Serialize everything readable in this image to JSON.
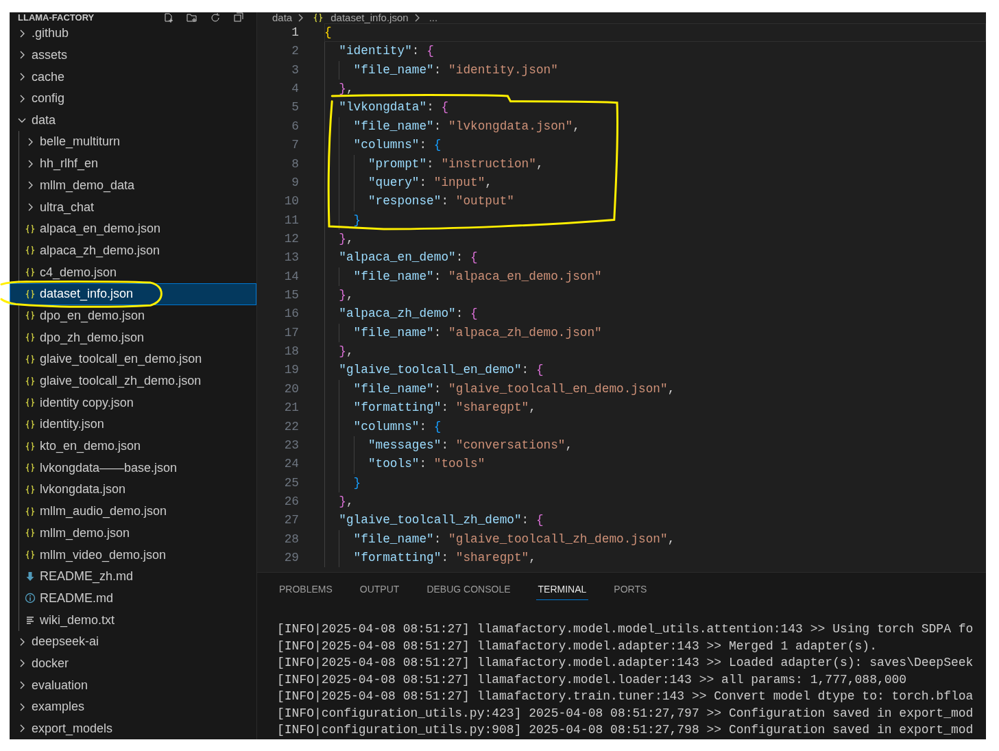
{
  "explorer": {
    "title": "LLAMA-FACTORY",
    "items": [
      {
        "name": ".github",
        "kind": "folder",
        "expanded": false,
        "selected": false
      },
      {
        "name": "assets",
        "kind": "folder",
        "expanded": false,
        "selected": false
      },
      {
        "name": "cache",
        "kind": "folder",
        "expanded": false,
        "selected": false
      },
      {
        "name": "config",
        "kind": "folder",
        "expanded": false,
        "selected": false
      },
      {
        "name": "data",
        "kind": "folder",
        "expanded": true,
        "selected": false,
        "children": [
          {
            "name": "belle_multiturn",
            "kind": "folder",
            "expanded": false,
            "selected": false
          },
          {
            "name": "hh_rlhf_en",
            "kind": "folder",
            "expanded": false,
            "selected": false
          },
          {
            "name": "mllm_demo_data",
            "kind": "folder",
            "expanded": false,
            "selected": false
          },
          {
            "name": "ultra_chat",
            "kind": "folder",
            "expanded": false,
            "selected": false
          },
          {
            "name": "alpaca_en_demo.json",
            "kind": "json",
            "selected": false
          },
          {
            "name": "alpaca_zh_demo.json",
            "kind": "json",
            "selected": false
          },
          {
            "name": "c4_demo.json",
            "kind": "json",
            "selected": false
          },
          {
            "name": "dataset_info.json",
            "kind": "json",
            "selected": true
          },
          {
            "name": "dpo_en_demo.json",
            "kind": "json",
            "selected": false
          },
          {
            "name": "dpo_zh_demo.json",
            "kind": "json",
            "selected": false
          },
          {
            "name": "glaive_toolcall_en_demo.json",
            "kind": "json",
            "selected": false
          },
          {
            "name": "glaive_toolcall_zh_demo.json",
            "kind": "json",
            "selected": false
          },
          {
            "name": "identity copy.json",
            "kind": "json",
            "selected": false
          },
          {
            "name": "identity.json",
            "kind": "json",
            "selected": false
          },
          {
            "name": "kto_en_demo.json",
            "kind": "json",
            "selected": false
          },
          {
            "name": "lvkongdata——base.json",
            "kind": "json",
            "selected": false
          },
          {
            "name": "lvkongdata.json",
            "kind": "json",
            "selected": false
          },
          {
            "name": "mllm_audio_demo.json",
            "kind": "json",
            "selected": false
          },
          {
            "name": "mllm_demo.json",
            "kind": "json",
            "selected": false
          },
          {
            "name": "mllm_video_demo.json",
            "kind": "json",
            "selected": false
          },
          {
            "name": "README_zh.md",
            "kind": "download",
            "selected": false
          },
          {
            "name": "README.md",
            "kind": "info",
            "selected": false
          },
          {
            "name": "wiki_demo.txt",
            "kind": "text",
            "selected": false
          }
        ]
      },
      {
        "name": "deepseek-ai",
        "kind": "folder",
        "expanded": false,
        "selected": false
      },
      {
        "name": "docker",
        "kind": "folder",
        "expanded": false,
        "selected": false
      },
      {
        "name": "evaluation",
        "kind": "folder",
        "expanded": false,
        "selected": false
      },
      {
        "name": "examples",
        "kind": "folder",
        "expanded": false,
        "selected": false
      },
      {
        "name": "export_models",
        "kind": "folder",
        "expanded": false,
        "selected": false
      }
    ]
  },
  "breadcrumb": [
    {
      "text": "data",
      "kind": "folder"
    },
    {
      "text": "dataset_info.json",
      "kind": "json"
    },
    {
      "text": "...",
      "kind": "more"
    }
  ],
  "editor": {
    "lines": [
      {
        "number": "1",
        "current": true,
        "tokens": [
          {
            "kind": "bracket",
            "text": "{",
            "color": "#ffd700"
          }
        ],
        "children": [
          {
            "number": "2",
            "current": false,
            "tokens": [
              {
                "kind": "key",
                "text": "\"identity\""
              },
              {
                "kind": "punct",
                "text": ": "
              },
              {
                "kind": "bracket",
                "text": "{",
                "color": "#da70d6"
              }
            ],
            "children": [
              {
                "number": "3",
                "current": false,
                "tokens": [
                  {
                    "kind": "key",
                    "text": "\"file_name\""
                  },
                  {
                    "kind": "punct",
                    "text": ": "
                  },
                  {
                    "kind": "string",
                    "text": "\"identity.json\""
                  }
                ]
              }
            ]
          },
          {
            "number": "4",
            "current": false,
            "tokens": [
              {
                "kind": "bracket",
                "text": "}",
                "color": "#da70d6"
              },
              {
                "kind": "punct",
                "text": ","
              }
            ]
          },
          {
            "number": "5",
            "current": false,
            "tokens": [
              {
                "kind": "key",
                "text": "\"lvkongdata\""
              },
              {
                "kind": "punct",
                "text": ": "
              },
              {
                "kind": "bracket",
                "text": "{",
                "color": "#da70d6"
              }
            ],
            "children": [
              {
                "number": "6",
                "current": false,
                "tokens": [
                  {
                    "kind": "key",
                    "text": "\"file_name\""
                  },
                  {
                    "kind": "punct",
                    "text": ": "
                  },
                  {
                    "kind": "string",
                    "text": "\"lvkongdata.json\""
                  },
                  {
                    "kind": "punct",
                    "text": ","
                  }
                ]
              },
              {
                "number": "7",
                "current": false,
                "tokens": [
                  {
                    "kind": "key",
                    "text": "\"columns\""
                  },
                  {
                    "kind": "punct",
                    "text": ": "
                  },
                  {
                    "kind": "bracket",
                    "text": "{",
                    "color": "#179fff"
                  }
                ],
                "children": [
                  {
                    "number": "8",
                    "current": false,
                    "tokens": [
                      {
                        "kind": "key",
                        "text": "\"prompt\""
                      },
                      {
                        "kind": "punct",
                        "text": ": "
                      },
                      {
                        "kind": "string",
                        "text": "\"instruction\""
                      },
                      {
                        "kind": "punct",
                        "text": ","
                      }
                    ]
                  },
                  {
                    "number": "9",
                    "current": false,
                    "tokens": [
                      {
                        "kind": "key",
                        "text": "\"query\""
                      },
                      {
                        "kind": "punct",
                        "text": ": "
                      },
                      {
                        "kind": "string",
                        "text": "\"input\""
                      },
                      {
                        "kind": "punct",
                        "text": ","
                      }
                    ]
                  },
                  {
                    "number": "10",
                    "current": false,
                    "tokens": [
                      {
                        "kind": "key",
                        "text": "\"response\""
                      },
                      {
                        "kind": "punct",
                        "text": ": "
                      },
                      {
                        "kind": "string",
                        "text": "\"output\""
                      }
                    ]
                  }
                ]
              },
              {
                "number": "11",
                "current": false,
                "tokens": [
                  {
                    "kind": "bracket",
                    "text": "}",
                    "color": "#179fff"
                  }
                ]
              }
            ]
          },
          {
            "number": "12",
            "current": false,
            "tokens": [
              {
                "kind": "bracket",
                "text": "}",
                "color": "#da70d6"
              },
              {
                "kind": "punct",
                "text": ","
              }
            ]
          },
          {
            "number": "13",
            "current": false,
            "tokens": [
              {
                "kind": "key",
                "text": "\"alpaca_en_demo\""
              },
              {
                "kind": "punct",
                "text": ": "
              },
              {
                "kind": "bracket",
                "text": "{",
                "color": "#da70d6"
              }
            ],
            "children": [
              {
                "number": "14",
                "current": false,
                "tokens": [
                  {
                    "kind": "key",
                    "text": "\"file_name\""
                  },
                  {
                    "kind": "punct",
                    "text": ": "
                  },
                  {
                    "kind": "string",
                    "text": "\"alpaca_en_demo.json\""
                  }
                ]
              }
            ]
          },
          {
            "number": "15",
            "current": false,
            "tokens": [
              {
                "kind": "bracket",
                "text": "}",
                "color": "#da70d6"
              },
              {
                "kind": "punct",
                "text": ","
              }
            ]
          },
          {
            "number": "16",
            "current": false,
            "tokens": [
              {
                "kind": "key",
                "text": "\"alpaca_zh_demo\""
              },
              {
                "kind": "punct",
                "text": ": "
              },
              {
                "kind": "bracket",
                "text": "{",
                "color": "#da70d6"
              }
            ],
            "children": [
              {
                "number": "17",
                "current": false,
                "tokens": [
                  {
                    "kind": "key",
                    "text": "\"file_name\""
                  },
                  {
                    "kind": "punct",
                    "text": ": "
                  },
                  {
                    "kind": "string",
                    "text": "\"alpaca_zh_demo.json\""
                  }
                ]
              }
            ]
          },
          {
            "number": "18",
            "current": false,
            "tokens": [
              {
                "kind": "bracket",
                "text": "}",
                "color": "#da70d6"
              },
              {
                "kind": "punct",
                "text": ","
              }
            ]
          },
          {
            "number": "19",
            "current": false,
            "tokens": [
              {
                "kind": "key",
                "text": "\"glaive_toolcall_en_demo\""
              },
              {
                "kind": "punct",
                "text": ": "
              },
              {
                "kind": "bracket",
                "text": "{",
                "color": "#da70d6"
              }
            ],
            "children": [
              {
                "number": "20",
                "current": false,
                "tokens": [
                  {
                    "kind": "key",
                    "text": "\"file_name\""
                  },
                  {
                    "kind": "punct",
                    "text": ": "
                  },
                  {
                    "kind": "string",
                    "text": "\"glaive_toolcall_en_demo.json\""
                  },
                  {
                    "kind": "punct",
                    "text": ","
                  }
                ]
              },
              {
                "number": "21",
                "current": false,
                "tokens": [
                  {
                    "kind": "key",
                    "text": "\"formatting\""
                  },
                  {
                    "kind": "punct",
                    "text": ": "
                  },
                  {
                    "kind": "string",
                    "text": "\"sharegpt\""
                  },
                  {
                    "kind": "punct",
                    "text": ","
                  }
                ]
              },
              {
                "number": "22",
                "current": false,
                "tokens": [
                  {
                    "kind": "key",
                    "text": "\"columns\""
                  },
                  {
                    "kind": "punct",
                    "text": ": "
                  },
                  {
                    "kind": "bracket",
                    "text": "{",
                    "color": "#179fff"
                  }
                ],
                "children": [
                  {
                    "number": "23",
                    "current": false,
                    "tokens": [
                      {
                        "kind": "key",
                        "text": "\"messages\""
                      },
                      {
                        "kind": "punct",
                        "text": ": "
                      },
                      {
                        "kind": "string",
                        "text": "\"conversations\""
                      },
                      {
                        "kind": "punct",
                        "text": ","
                      }
                    ]
                  },
                  {
                    "number": "24",
                    "current": false,
                    "tokens": [
                      {
                        "kind": "key",
                        "text": "\"tools\""
                      },
                      {
                        "kind": "punct",
                        "text": ": "
                      },
                      {
                        "kind": "string",
                        "text": "\"tools\""
                      }
                    ]
                  }
                ]
              },
              {
                "number": "25",
                "current": false,
                "tokens": [
                  {
                    "kind": "bracket",
                    "text": "}",
                    "color": "#179fff"
                  }
                ]
              }
            ]
          },
          {
            "number": "26",
            "current": false,
            "tokens": [
              {
                "kind": "bracket",
                "text": "}",
                "color": "#da70d6"
              },
              {
                "kind": "punct",
                "text": ","
              }
            ]
          },
          {
            "number": "27",
            "current": false,
            "tokens": [
              {
                "kind": "key",
                "text": "\"glaive_toolcall_zh_demo\""
              },
              {
                "kind": "punct",
                "text": ": "
              },
              {
                "kind": "bracket",
                "text": "{",
                "color": "#da70d6"
              }
            ],
            "children": [
              {
                "number": "28",
                "current": false,
                "tokens": [
                  {
                    "kind": "key",
                    "text": "\"file_name\""
                  },
                  {
                    "kind": "punct",
                    "text": ": "
                  },
                  {
                    "kind": "string",
                    "text": "\"glaive_toolcall_zh_demo.json\""
                  },
                  {
                    "kind": "punct",
                    "text": ","
                  }
                ]
              },
              {
                "number": "29",
                "current": false,
                "tokens": [
                  {
                    "kind": "key",
                    "text": "\"formatting\""
                  },
                  {
                    "kind": "punct",
                    "text": ": "
                  },
                  {
                    "kind": "string",
                    "text": "\"sharegpt\""
                  },
                  {
                    "kind": "punct",
                    "text": ","
                  }
                ]
              }
            ]
          }
        ]
      }
    ]
  },
  "panel": {
    "tabs": [
      {
        "label": "PROBLEMS",
        "selected": false
      },
      {
        "label": "OUTPUT",
        "selected": false
      },
      {
        "label": "DEBUG CONSOLE",
        "selected": false
      },
      {
        "label": "TERMINAL",
        "selected": true
      },
      {
        "label": "PORTS",
        "selected": false
      }
    ],
    "terminal_lines": [
      "[INFO|2025-04-08 08:51:27] llamafactory.model.model_utils.attention:143 >> Using torch SDPA fo",
      "[INFO|2025-04-08 08:51:27] llamafactory.model.adapter:143 >> Merged 1 adapter(s).",
      "[INFO|2025-04-08 08:51:27] llamafactory.model.adapter:143 >> Loaded adapter(s): saves\\DeepSeek",
      "[INFO|2025-04-08 08:51:27] llamafactory.model.loader:143 >> all params: 1,777,088,000",
      "[INFO|2025-04-08 08:51:27] llamafactory.train.tuner:143 >> Convert model dtype to: torch.bfloa",
      "[INFO|configuration_utils.py:423] 2025-04-08 08:51:27,797 >> Configuration saved in export_mod",
      "[INFO|configuration_utils.py:908] 2025-04-08 08:51:27,798 >> Configuration saved in export_mod"
    ]
  },
  "annotations": [
    {
      "kind": "box"
    },
    {
      "kind": "loop"
    }
  ]
}
